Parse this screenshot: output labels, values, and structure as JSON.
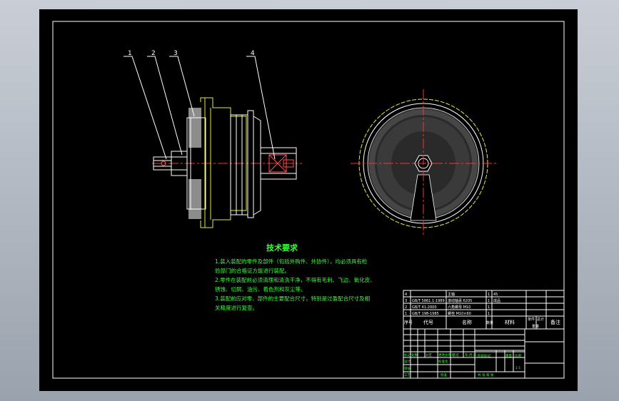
{
  "tech": {
    "title": "技术要求",
    "lines": [
      "1.装入装配的零件及部件（包括外购件、外协件），均必须具有检",
      "验部门的合格证方能进行装配。",
      "2.零件在装配前必须清理和清洗干净，不得有毛刺、飞边、氧化皮、",
      "锈蚀、切屑、油污、着色剂和灰尘等。",
      "3.装配前应对零、部件的主要配合尺寸，特别是过盈配合尺寸及相",
      "关精度进行复查。"
    ]
  },
  "balloons": [
    "1",
    "2",
    "3",
    "4"
  ],
  "bom": {
    "rows": [
      {
        "no": "4",
        "code": "",
        "name": "主轴",
        "qty": "1",
        "material": "45"
      },
      {
        "no": "3",
        "code": "GB/T 5861.1-1989",
        "name": "滚动轴承 6205",
        "qty": "1",
        "material": "成品"
      },
      {
        "no": "2",
        "code": "GB/T 41-2000",
        "name": "六角螺母 M10",
        "qty": "1",
        "material": ""
      },
      {
        "no": "1",
        "code": "GB/T 198-1985",
        "name": "螺栓 M10×60",
        "qty": "1",
        "material": ""
      }
    ],
    "header": {
      "no": "序号",
      "code": "代号",
      "name": "名称",
      "qty": "数量",
      "material": "材料",
      "single": "单件",
      "total": "总计",
      "weight": "重量",
      "remark": "备注"
    }
  },
  "title_block": {
    "marks": "标记",
    "count": "处数",
    "zone": "分区",
    "change_doc": "更改文件号",
    "sign": "签名",
    "date": "年.月.日",
    "designer": "设计",
    "standard": "标准化",
    "stage": "阶段标记",
    "weight": "重量",
    "scale": "比例",
    "scale_value": "1:1",
    "review": "审核",
    "process": "工艺",
    "approve": "批准",
    "sheets": "共  张  第  张"
  }
}
